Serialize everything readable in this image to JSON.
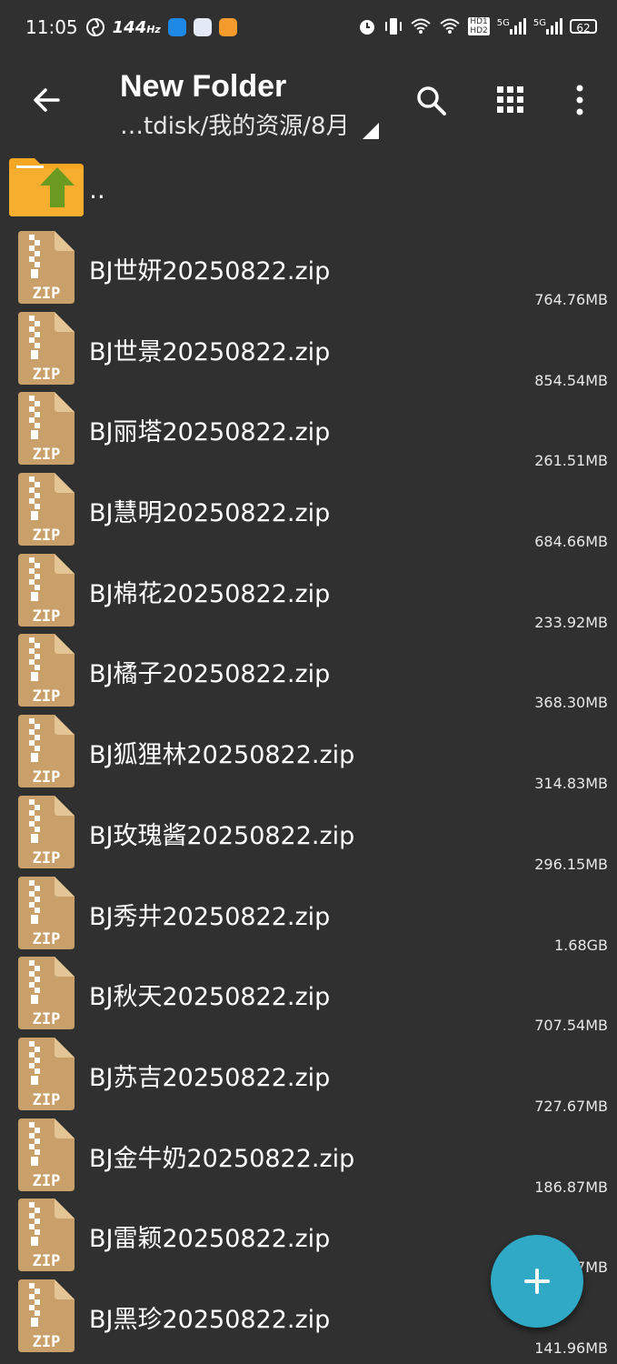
{
  "status_bar": {
    "time": "11:05",
    "refresh_rate": "144",
    "refresh_unit": "Hz",
    "hd1": "HD1",
    "hd2": "HD2",
    "net1": "5G",
    "net2": "5G",
    "battery": "62"
  },
  "toolbar": {
    "title": "New Folder",
    "path": "…tdisk/我的资源/8月"
  },
  "parent_dir_label": "..",
  "files": [
    {
      "name": "BJ世妍20250822.zip",
      "size": "764.76MB"
    },
    {
      "name": "BJ世景20250822.zip",
      "size": "854.54MB"
    },
    {
      "name": "BJ丽塔20250822.zip",
      "size": "261.51MB"
    },
    {
      "name": "BJ慧明20250822.zip",
      "size": "684.66MB"
    },
    {
      "name": "BJ棉花20250822.zip",
      "size": "233.92MB"
    },
    {
      "name": "BJ橘子20250822.zip",
      "size": "368.30MB"
    },
    {
      "name": "BJ狐狸林20250822.zip",
      "size": "314.83MB"
    },
    {
      "name": "BJ玫瑰酱20250822.zip",
      "size": "296.15MB"
    },
    {
      "name": "BJ秀井20250822.zip",
      "size": "1.68GB"
    },
    {
      "name": "BJ秋天20250822.zip",
      "size": "707.54MB"
    },
    {
      "name": "BJ苏吉20250822.zip",
      "size": "727.67MB"
    },
    {
      "name": "BJ金牛奶20250822.zip",
      "size": "186.87MB"
    },
    {
      "name": "BJ雷颖20250822.zip",
      "size": "7MB"
    },
    {
      "name": "BJ黑珍20250822.zip",
      "size": "141.96MB"
    }
  ],
  "zip_label": "ZIP",
  "colors": {
    "background": "#303030",
    "folder": "#f5a623",
    "up_arrow": "#6a9a1f",
    "zip_icon": "#c9a06a",
    "fab": "#2fa9c6"
  },
  "icons": {
    "back": "arrow-left-icon",
    "search": "search-icon",
    "grid": "grid-view-icon",
    "more": "more-vert-icon",
    "fab": "plus-icon"
  }
}
